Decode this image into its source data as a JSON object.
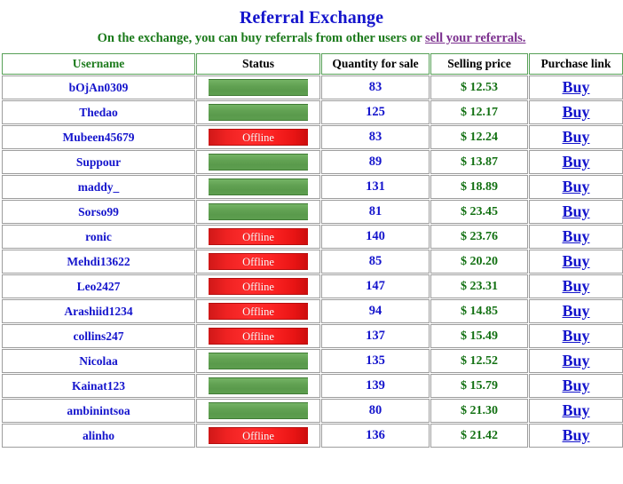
{
  "header": {
    "title": "Referral Exchange",
    "subtitle_prefix": "On the exchange, you can buy referrals from other users or ",
    "subtitle_link": "sell your referrals.",
    "title_color": "#1414cc",
    "subtitle_color": "#1b7a1b",
    "link_color": "#7b2f8e"
  },
  "table": {
    "columns": [
      {
        "key": "username",
        "label": "Username"
      },
      {
        "key": "status",
        "label": "Status"
      },
      {
        "key": "quantity",
        "label": "Quantity for sale"
      },
      {
        "key": "price",
        "label": "Selling price"
      },
      {
        "key": "purchase",
        "label": "Purchase link"
      }
    ],
    "status_labels": {
      "online": "",
      "offline": "Offline"
    },
    "buy_label": "Buy",
    "colors": {
      "online_bar": "#62a253",
      "offline_bar": "#ff2d2d",
      "header_border": "#57a057",
      "cell_border": "#9d9d9d",
      "username_text": "#1414cc",
      "quantity_text": "#1414cc",
      "price_text": "#127012",
      "buy_text": "#1414cc"
    },
    "rows": [
      {
        "username": "bOjAn0309",
        "status": "online",
        "quantity": "83",
        "price": "$ 12.53",
        "purchase": "Buy"
      },
      {
        "username": "Thedao",
        "status": "online",
        "quantity": "125",
        "price": "$ 12.17",
        "purchase": "Buy"
      },
      {
        "username": "Mubeen45679",
        "status": "offline",
        "quantity": "83",
        "price": "$ 12.24",
        "purchase": "Buy"
      },
      {
        "username": "Suppour",
        "status": "online",
        "quantity": "89",
        "price": "$ 13.87",
        "purchase": "Buy"
      },
      {
        "username": "maddy_",
        "status": "online",
        "quantity": "131",
        "price": "$ 18.89",
        "purchase": "Buy"
      },
      {
        "username": "Sorso99",
        "status": "online",
        "quantity": "81",
        "price": "$ 23.45",
        "purchase": "Buy"
      },
      {
        "username": "ronic",
        "status": "offline",
        "quantity": "140",
        "price": "$ 23.76",
        "purchase": "Buy"
      },
      {
        "username": "Mehdi13622",
        "status": "offline",
        "quantity": "85",
        "price": "$ 20.20",
        "purchase": "Buy"
      },
      {
        "username": "Leo2427",
        "status": "offline",
        "quantity": "147",
        "price": "$ 23.31",
        "purchase": "Buy"
      },
      {
        "username": "Arashiid1234",
        "status": "offline",
        "quantity": "94",
        "price": "$ 14.85",
        "purchase": "Buy"
      },
      {
        "username": "collins247",
        "status": "offline",
        "quantity": "137",
        "price": "$ 15.49",
        "purchase": "Buy"
      },
      {
        "username": "Nicolaa",
        "status": "online",
        "quantity": "135",
        "price": "$ 12.52",
        "purchase": "Buy"
      },
      {
        "username": "Kainat123",
        "status": "online",
        "quantity": "139",
        "price": "$ 15.79",
        "purchase": "Buy"
      },
      {
        "username": "ambinintsoa",
        "status": "online",
        "quantity": "80",
        "price": "$ 21.30",
        "purchase": "Buy"
      },
      {
        "username": "alinho",
        "status": "offline",
        "quantity": "136",
        "price": "$ 21.42",
        "purchase": "Buy"
      }
    ]
  }
}
